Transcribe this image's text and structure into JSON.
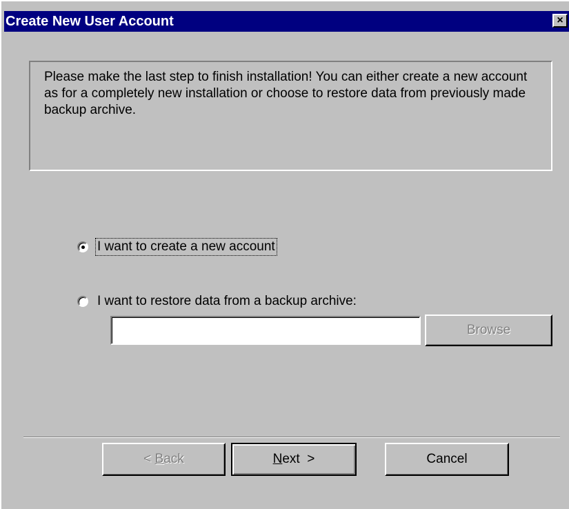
{
  "window": {
    "title": "Create New User Account",
    "close_glyph": "×"
  },
  "info": {
    "text": "Please make the last step to finish installation! You can either create a new account as for a completely new installation or choose to restore data from previously made backup archive."
  },
  "options": {
    "create_new": {
      "label": "I want to create a new account",
      "checked": true
    },
    "restore": {
      "label": "I want to restore data from a backup archive:",
      "checked": false
    }
  },
  "backup_path": {
    "value": ""
  },
  "buttons": {
    "browse": "Browse",
    "back_prefix": "< ",
    "back_accel": "B",
    "back_rest": "ack",
    "next_accel": "N",
    "next_rest": "ext  >",
    "cancel": "Cancel"
  },
  "icons": {
    "close": "close-icon"
  }
}
